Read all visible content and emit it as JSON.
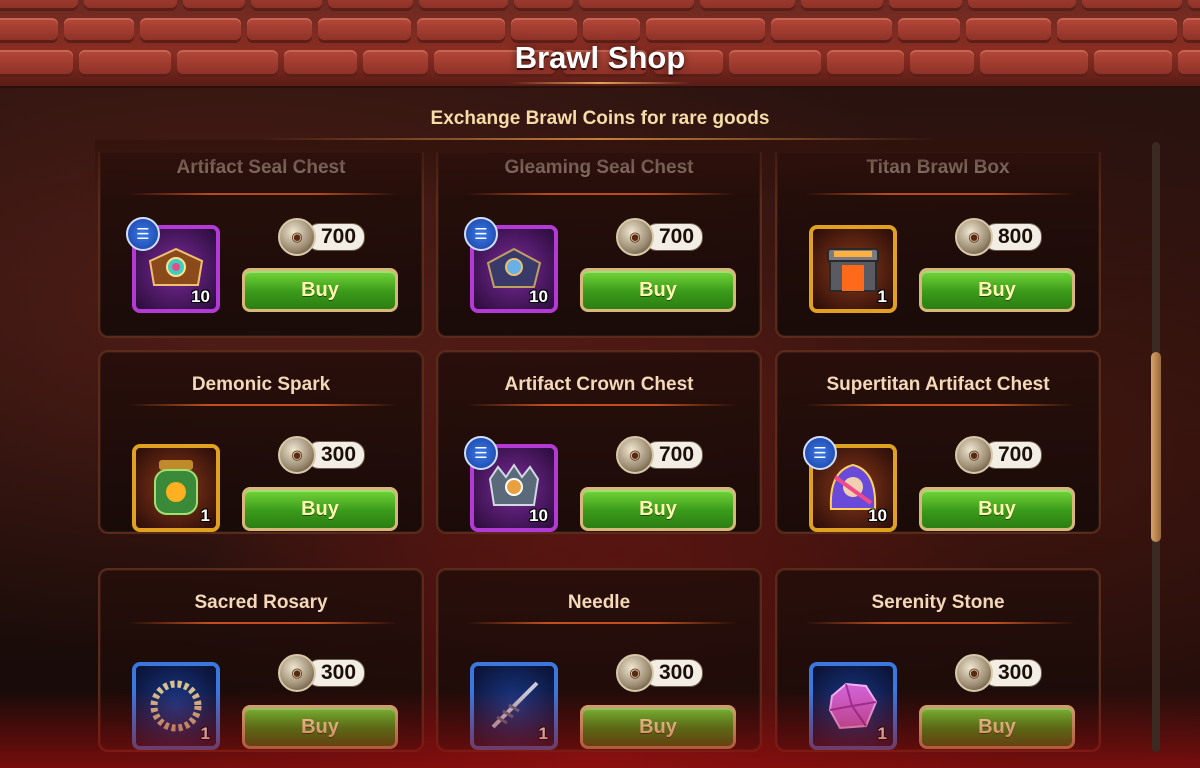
{
  "header": {
    "title": "Brawl Shop",
    "subtitle": "Exchange Brawl Coins for rare goods"
  },
  "items": [
    {
      "name": "Artifact Seal Chest",
      "price": "700",
      "count": "10",
      "frame": "purple",
      "info": true,
      "icon": "artifact-chest-icon",
      "buy": "Buy"
    },
    {
      "name": "Gleaming Seal Chest",
      "price": "700",
      "count": "10",
      "frame": "purple",
      "info": true,
      "icon": "seal-chest-icon",
      "buy": "Buy"
    },
    {
      "name": "Titan Brawl Box",
      "price": "800",
      "count": "1",
      "frame": "gold",
      "info": false,
      "icon": "titan-box-icon",
      "buy": "Buy"
    },
    {
      "name": "Demonic Spark",
      "price": "300",
      "count": "1",
      "frame": "gold",
      "info": false,
      "icon": "spark-jar-icon",
      "buy": "Buy"
    },
    {
      "name": "Artifact Crown Chest",
      "price": "700",
      "count": "10",
      "frame": "purple",
      "info": true,
      "icon": "crown-chest-icon",
      "buy": "Buy"
    },
    {
      "name": "Supertitan Artifact Chest",
      "price": "700",
      "count": "10",
      "frame": "gold",
      "info": true,
      "icon": "supertitan-chest-icon",
      "buy": "Buy"
    },
    {
      "name": "Sacred Rosary",
      "price": "300",
      "count": "1",
      "frame": "blue",
      "info": false,
      "icon": "rosary-icon",
      "buy": "Buy"
    },
    {
      "name": "Needle",
      "price": "300",
      "count": "1",
      "frame": "blue",
      "info": false,
      "icon": "needle-icon",
      "buy": "Buy"
    },
    {
      "name": "Serenity Stone",
      "price": "300",
      "count": "1",
      "frame": "blue",
      "info": false,
      "icon": "gem-icon",
      "buy": "Buy"
    }
  ]
}
